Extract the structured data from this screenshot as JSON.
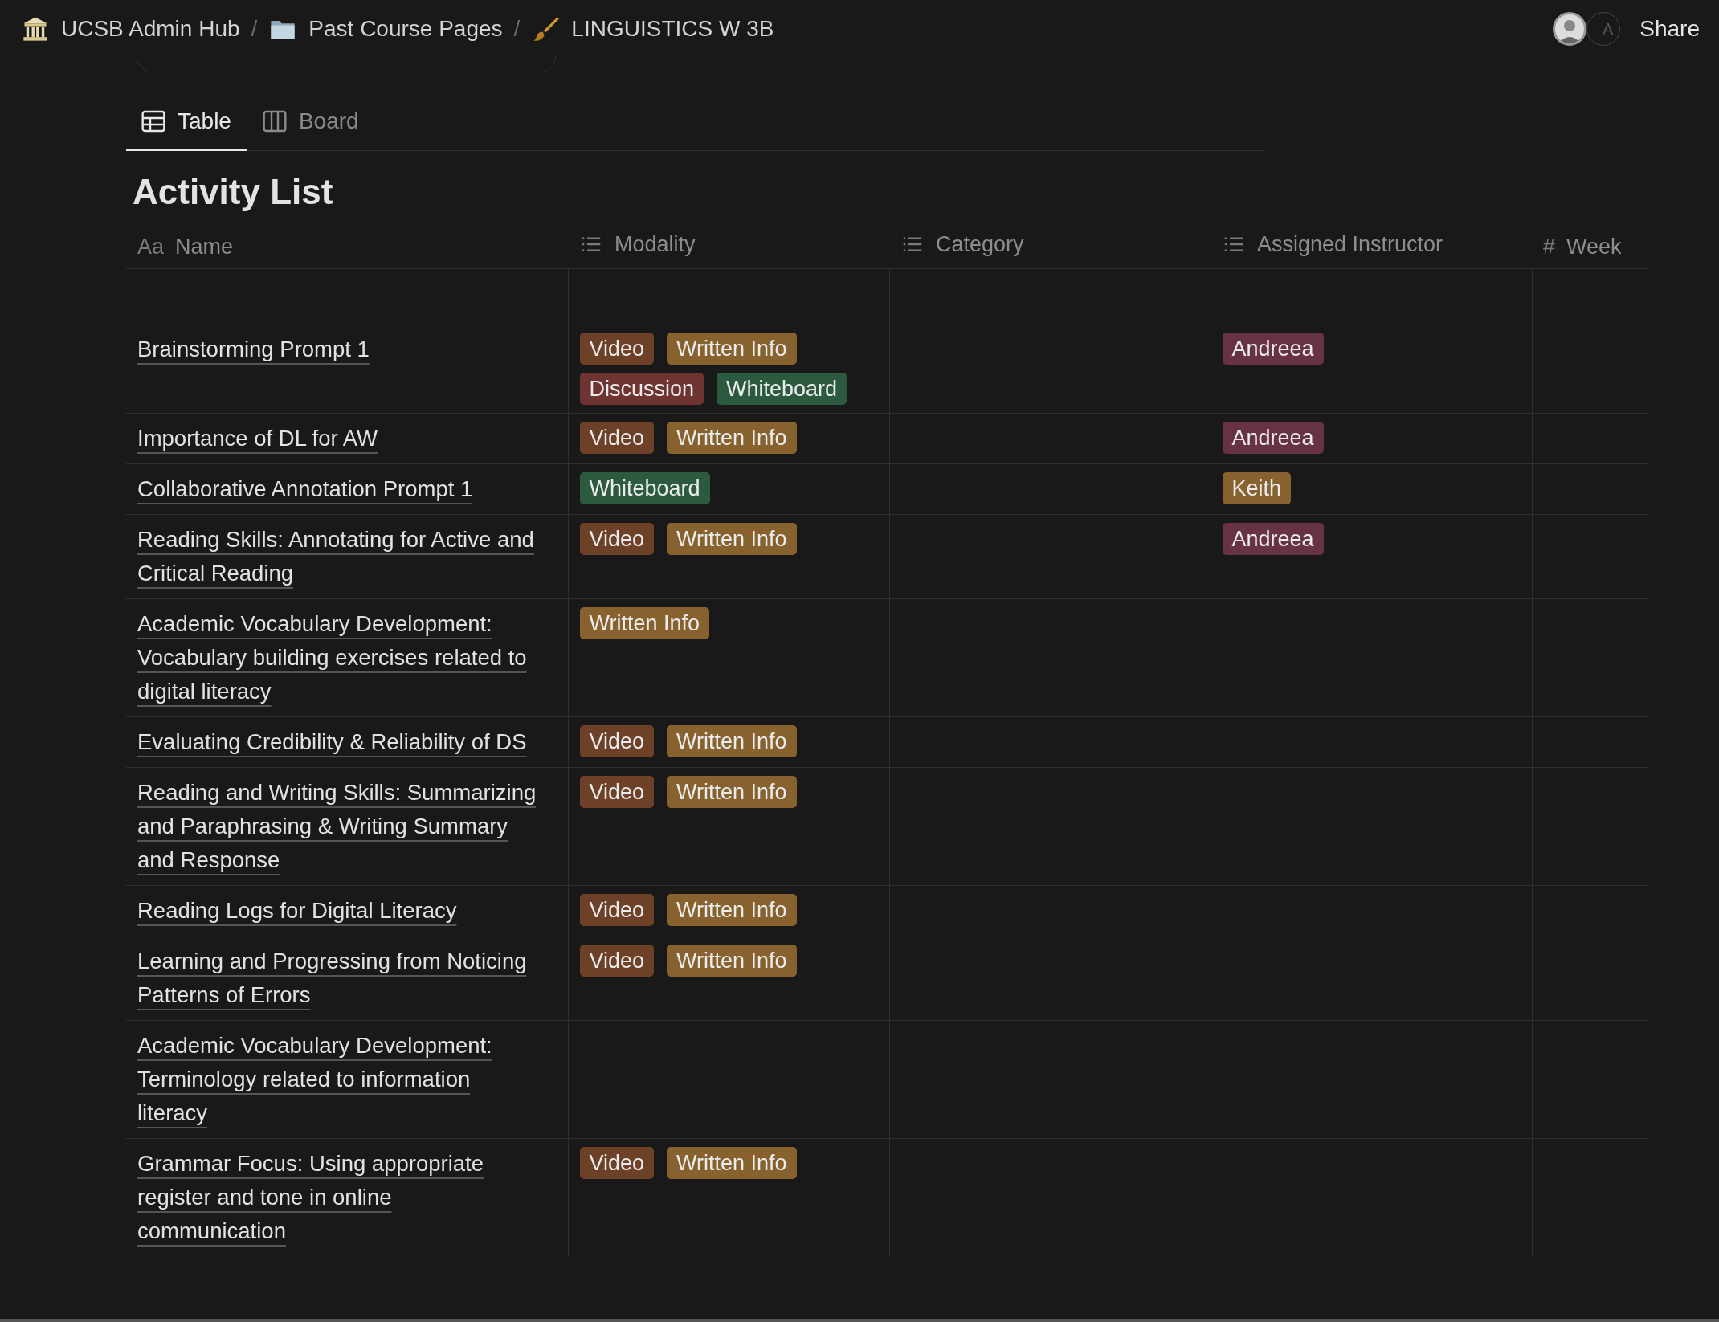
{
  "breadcrumbs": [
    {
      "kind": "building",
      "label": "UCSB Admin Hub"
    },
    {
      "kind": "folder",
      "label": "Past Course Pages"
    },
    {
      "kind": "brush",
      "label": "LINGUISTICS W 3B"
    }
  ],
  "separator": "/",
  "avatars": [
    {
      "kind": "photo"
    },
    {
      "kind": "letter",
      "letter": "A"
    }
  ],
  "share": "Share",
  "tabs": [
    {
      "kind": "table",
      "label": "Table",
      "selected": true
    },
    {
      "kind": "board",
      "label": "Board",
      "selected": false
    }
  ],
  "title": "Activity List",
  "columns": [
    {
      "kind": "title",
      "glyph": "Aa",
      "label": "Name"
    },
    {
      "kind": "list",
      "label": "Modality"
    },
    {
      "kind": "list",
      "label": "Category"
    },
    {
      "kind": "list",
      "label": "Assigned Instructor"
    },
    {
      "kind": "number",
      "glyph": "#",
      "label": "Week"
    }
  ],
  "rows": [
    {
      "name": "",
      "modality": [],
      "instructor": []
    },
    {
      "name": "Brainstorming Prompt 1",
      "modality": [
        {
          "label": "Video",
          "color": "#6c4127"
        },
        {
          "label": "Written Info",
          "color": "#87622e"
        },
        {
          "label": "Discussion",
          "color": "#6e3432"
        },
        {
          "label": "Whiteboard",
          "color": "#2b5a3e"
        }
      ],
      "instructor": [
        {
          "label": "Andreea",
          "color": "#683246"
        }
      ]
    },
    {
      "name": "Importance of DL for AW",
      "modality": [
        {
          "label": "Video",
          "color": "#6c4127"
        },
        {
          "label": "Written Info",
          "color": "#87622e"
        }
      ],
      "instructor": [
        {
          "label": "Andreea",
          "color": "#683246"
        }
      ]
    },
    {
      "name": "Collaborative Annotation Prompt 1",
      "modality": [
        {
          "label": "Whiteboard",
          "color": "#2b5a3e"
        }
      ],
      "instructor": [
        {
          "label": "Keith",
          "color": "#87622e"
        }
      ]
    },
    {
      "name": "Reading Skills: Annotating for Active and Critical Reading",
      "modality": [
        {
          "label": "Video",
          "color": "#6c4127"
        },
        {
          "label": "Written Info",
          "color": "#87622e"
        }
      ],
      "instructor": [
        {
          "label": "Andreea",
          "color": "#683246"
        }
      ]
    },
    {
      "name": "Academic Vocabulary Development: Vocabulary building exercises related to digital literacy",
      "modality": [
        {
          "label": "Written Info",
          "color": "#87622e"
        }
      ],
      "instructor": []
    },
    {
      "name": "Evaluating Credibility & Reliability of DS",
      "modality": [
        {
          "label": "Video",
          "color": "#6c4127"
        },
        {
          "label": "Written Info",
          "color": "#87622e"
        }
      ],
      "instructor": []
    },
    {
      "name": "Reading and Writing Skills: Summarizing and Paraphrasing & Writing Summary and Response",
      "modality": [
        {
          "label": "Video",
          "color": "#6c4127"
        },
        {
          "label": "Written Info",
          "color": "#87622e"
        }
      ],
      "instructor": []
    },
    {
      "name": "Reading Logs for Digital Literacy",
      "modality": [
        {
          "label": "Video",
          "color": "#6c4127"
        },
        {
          "label": "Written Info",
          "color": "#87622e"
        }
      ],
      "instructor": []
    },
    {
      "name": "Learning and Progressing from Noticing Patterns of Errors",
      "modality": [
        {
          "label": "Video",
          "color": "#6c4127"
        },
        {
          "label": "Written Info",
          "color": "#87622e"
        }
      ],
      "instructor": []
    },
    {
      "name": "Academic Vocabulary Development: Terminology related to information literacy",
      "modality": [],
      "instructor": []
    },
    {
      "name": "Grammar Focus: Using appropriate register and tone in online communication",
      "modality": [
        {
          "label": "Video",
          "color": "#6c4127"
        },
        {
          "label": "Written Info",
          "color": "#87622e"
        }
      ],
      "instructor": []
    }
  ]
}
